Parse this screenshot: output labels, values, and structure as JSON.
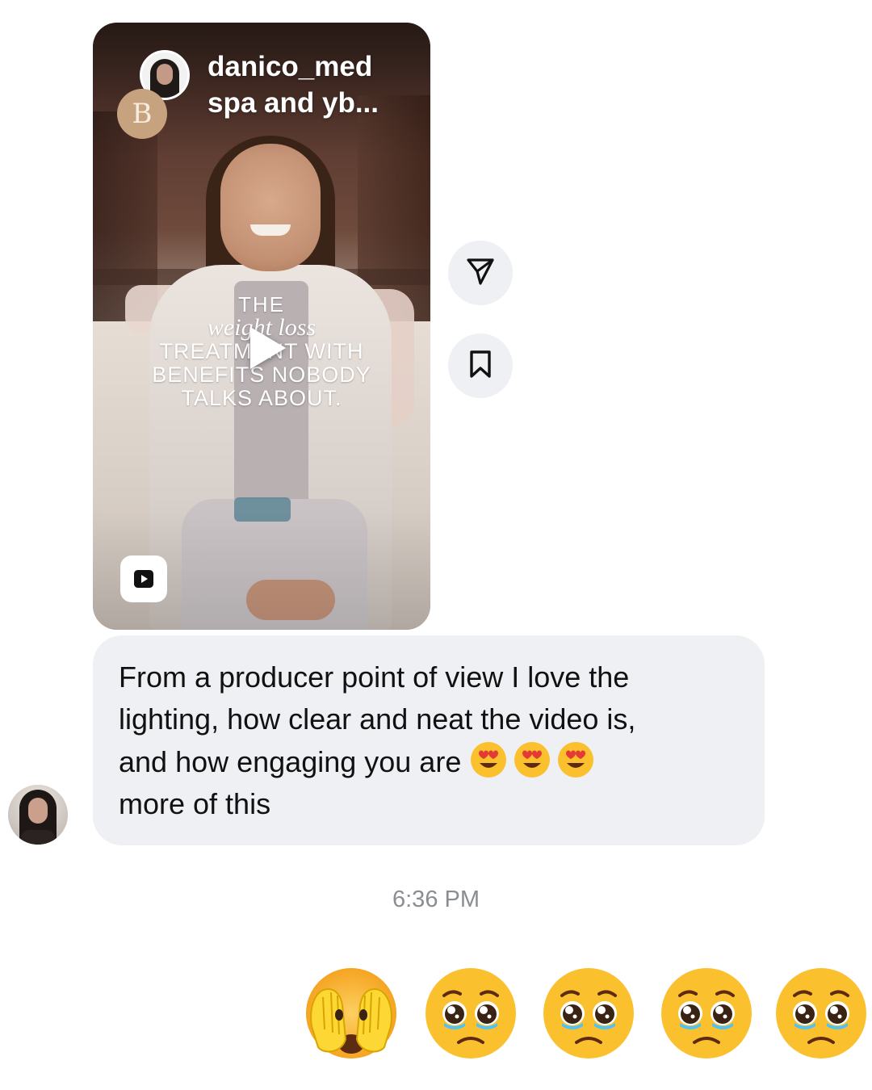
{
  "shared_reel": {
    "account_title_line1": "danico_med",
    "account_title_line2": "spa and yb...",
    "brand_logo_letter": "B",
    "overlay": {
      "line1": "THE",
      "line2": "weight loss",
      "line3": "TREATMENT WITH",
      "line4": "BENEFITS NOBODY",
      "line5": "TALKS ABOUT."
    },
    "play_icon": "play-icon",
    "reels_badge_icon": "reels-icon"
  },
  "side_actions": [
    {
      "icon": "send-icon"
    },
    {
      "icon": "bookmark-icon"
    }
  ],
  "message": {
    "text_before_emojis": "From a producer point of view I love the\nlighting, how clear and neat the video is,\nand how engaging you are ",
    "inline_emojis": [
      "heart-eyes-emoji",
      "heart-eyes-emoji",
      "heart-eyes-emoji"
    ],
    "text_after_emojis": "\nmore of this"
  },
  "timestamp": "6:36 PM",
  "reply": {
    "emojis": [
      "see-no-evil-face-emoji",
      "pleading-face-emoji",
      "pleading-face-emoji",
      "pleading-face-emoji",
      "pleading-face-emoji"
    ]
  },
  "colors": {
    "bubble_bg": "#eff0f3",
    "action_bg": "#eef0f3",
    "timestamp": "#8a8d91"
  }
}
